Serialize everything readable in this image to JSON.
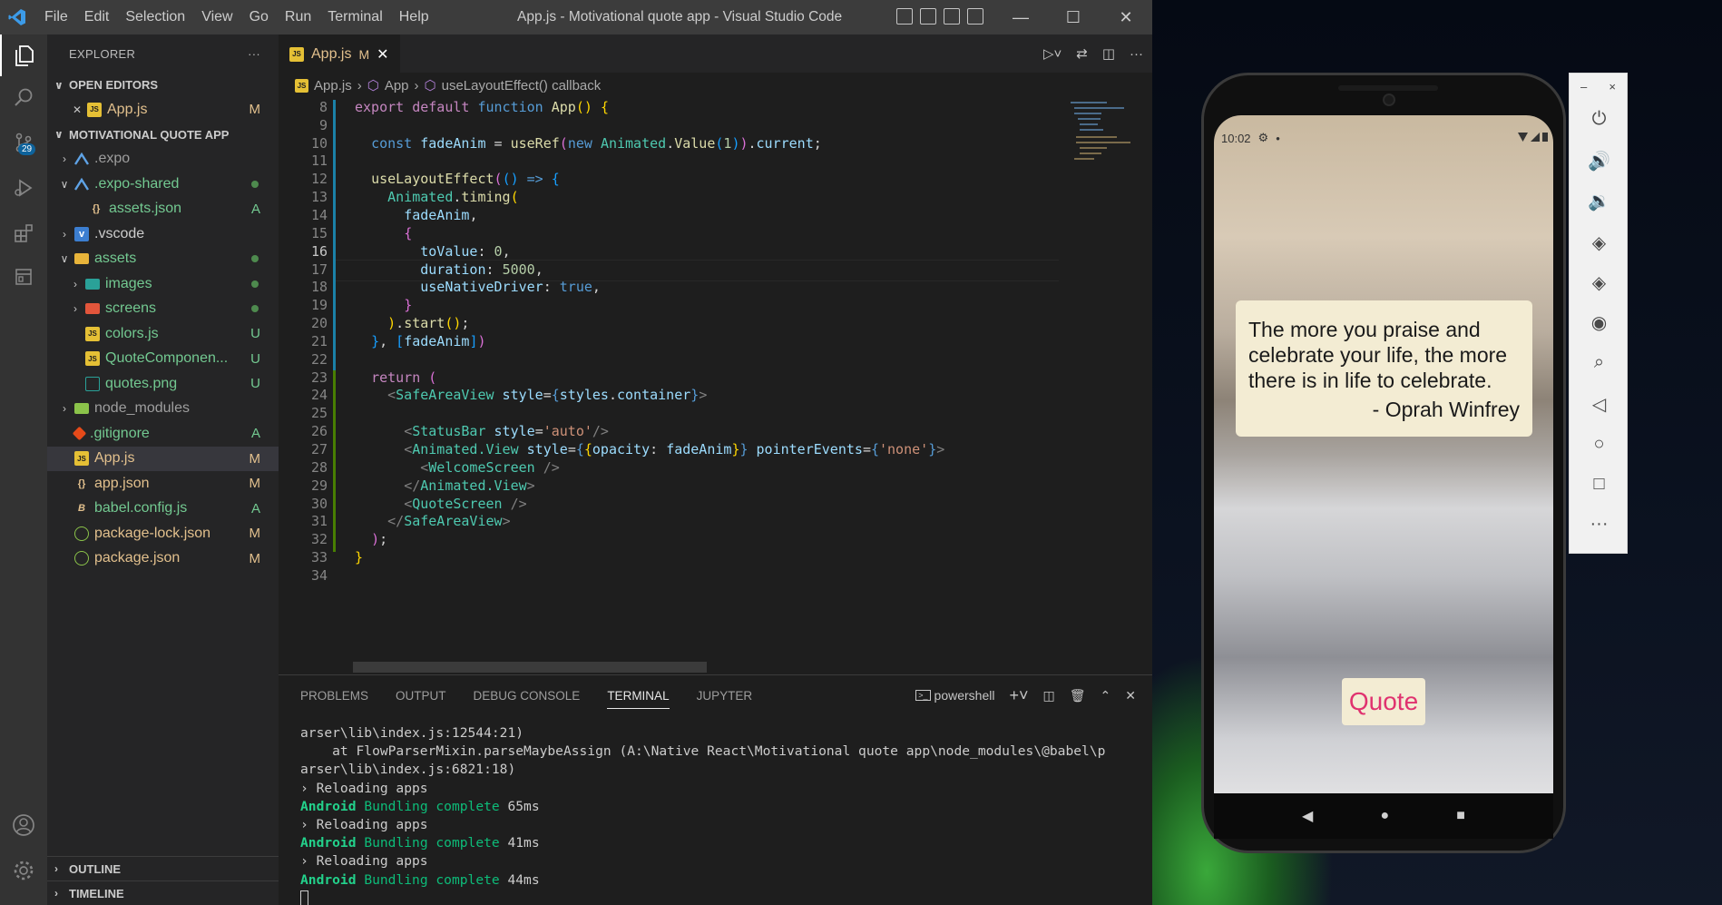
{
  "window": {
    "title": "App.js - Motivational quote app - Visual Studio Code",
    "menu": [
      "File",
      "Edit",
      "Selection",
      "View",
      "Go",
      "Run",
      "Terminal",
      "Help"
    ]
  },
  "activity": {
    "scm_badge": "29"
  },
  "sidebar": {
    "header": "EXPLORER",
    "more": "···",
    "open_editors_label": "OPEN EDITORS",
    "open_editors": [
      {
        "name": "App.js",
        "status": "M"
      }
    ],
    "project_label": "MOTIVATIONAL QUOTE APP",
    "tree": [
      {
        "name": ".expo",
        "status": ""
      },
      {
        "name": ".expo-shared",
        "status": ""
      },
      {
        "name": "assets.json",
        "status": "A"
      },
      {
        "name": ".vscode",
        "status": ""
      },
      {
        "name": "assets",
        "status": ""
      },
      {
        "name": "images",
        "status": ""
      },
      {
        "name": "screens",
        "status": ""
      },
      {
        "name": "colors.js",
        "status": "U"
      },
      {
        "name": "QuoteComponen...",
        "status": "U"
      },
      {
        "name": "quotes.png",
        "status": "U"
      },
      {
        "name": "node_modules",
        "status": ""
      },
      {
        "name": ".gitignore",
        "status": "A"
      },
      {
        "name": "App.js",
        "status": "M"
      },
      {
        "name": "app.json",
        "status": "M"
      },
      {
        "name": "babel.config.js",
        "status": "A"
      },
      {
        "name": "package-lock.json",
        "status": "M"
      },
      {
        "name": "package.json",
        "status": "M"
      }
    ],
    "outline_label": "OUTLINE",
    "timeline_label": "TIMELINE"
  },
  "editor": {
    "tab": {
      "name": "App.js",
      "status": "M"
    },
    "breadcrumb": [
      "App.js",
      "App",
      "useLayoutEffect() callback"
    ],
    "line_numbers": [
      "8",
      "9",
      "10",
      "11",
      "12",
      "13",
      "14",
      "15",
      "16",
      "17",
      "18",
      "19",
      "20",
      "21",
      "22",
      "23",
      "24",
      "25",
      "26",
      "27",
      "28",
      "29",
      "30",
      "31",
      "32",
      "33",
      "34"
    ],
    "current_line": "16"
  },
  "panel": {
    "tabs": [
      "PROBLEMS",
      "OUTPUT",
      "DEBUG CONSOLE",
      "TERMINAL",
      "JUPYTER"
    ],
    "active_tab": "TERMINAL",
    "shell": "powershell",
    "terminal": {
      "line1": "arser\\lib\\index.js:12544:21)",
      "line2": "    at FlowParserMixin.parseMaybeAssign (A:\\Native React\\Motivational quote app\\node_modules\\@babel\\p",
      "line3": "arser\\lib\\index.js:6821:18)",
      "reload": "› Reloading apps",
      "android": "Android",
      "bundling": "Bundling complete",
      "times": [
        "65ms",
        "41ms",
        "44ms"
      ]
    }
  },
  "phone": {
    "time": "10:02",
    "quote": "The more you praise and celebrate your life, the more there is in life to celebrate.",
    "author": "- Oprah Winfrey",
    "button": "Quote"
  },
  "emulator": {
    "minimize": "–",
    "close": "×",
    "more": "···"
  }
}
